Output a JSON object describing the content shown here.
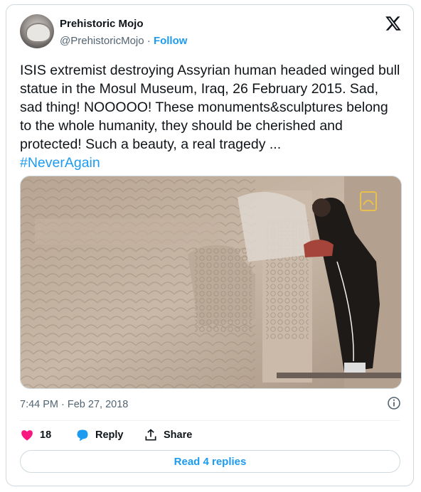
{
  "author": {
    "name": "Prehistoric Mojo",
    "handle": "@PrehistoricMojo",
    "separator": "·",
    "follow_label": "Follow"
  },
  "brand_icon": "x-logo-icon",
  "tweet": {
    "text": "ISIS extremist destroying Assyrian human headed winged bull statue in the Mosul Museum, Iraq, 26 February 2015. Sad, sad thing! NOOOOO! These monuments&sculptures belong to the whole humanity, they should be cherished and protected! Such a beauty, a real tragedy ...",
    "hashtag": "#NeverAgain"
  },
  "media": {
    "watermark_icon": "channel-logo-icon"
  },
  "meta": {
    "timestamp": "7:44 PM · Feb 27, 2018",
    "info_icon": "info-icon"
  },
  "actions": {
    "like_count": "18",
    "reply_label": "Reply",
    "share_label": "Share"
  },
  "read_replies_label": "Read 4 replies",
  "colors": {
    "accent": "#1d9bf0",
    "like": "#f91880",
    "text": "#0f1419",
    "muted": "#536471",
    "border": "#cfd9de"
  }
}
